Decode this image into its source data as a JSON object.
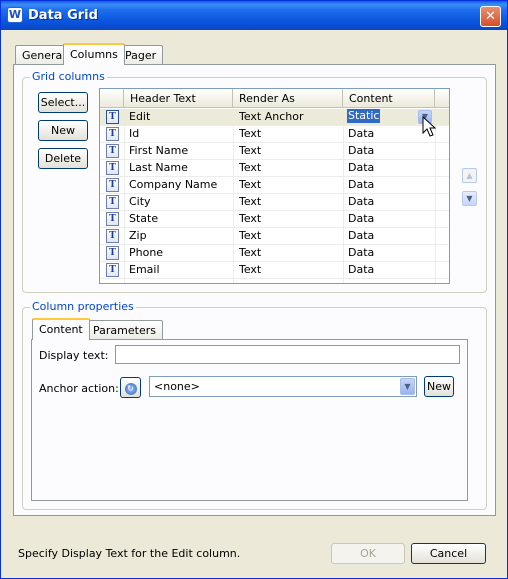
{
  "window": {
    "title": "Data Grid"
  },
  "tabs": [
    {
      "label": "General"
    },
    {
      "label": "Columns"
    },
    {
      "label": "Pager"
    }
  ],
  "grid_columns": {
    "group_label": "Grid columns",
    "buttons": {
      "select": "Select...",
      "new": "New",
      "delete": "Delete"
    },
    "headers": [
      "Header Text",
      "Render As",
      "Content Source"
    ],
    "rows": [
      {
        "icon": "T",
        "header": "Edit",
        "render": "Text Anchor",
        "source": "Static"
      },
      {
        "icon": "T",
        "header": "Id",
        "render": "Text",
        "source": "Data"
      },
      {
        "icon": "T",
        "header": "First Name",
        "render": "Text",
        "source": "Data"
      },
      {
        "icon": "T",
        "header": "Last Name",
        "render": "Text",
        "source": "Data"
      },
      {
        "icon": "T",
        "header": "Company Name",
        "render": "Text",
        "source": "Data"
      },
      {
        "icon": "T",
        "header": "City",
        "render": "Text",
        "source": "Data"
      },
      {
        "icon": "T",
        "header": "State",
        "render": "Text",
        "source": "Data"
      },
      {
        "icon": "T",
        "header": "Zip",
        "render": "Text",
        "source": "Data"
      },
      {
        "icon": "T",
        "header": "Phone",
        "render": "Text",
        "source": "Data"
      },
      {
        "icon": "T",
        "header": "Email",
        "render": "Text",
        "source": "Data"
      }
    ]
  },
  "column_properties": {
    "group_label": "Column properties",
    "tabs": [
      {
        "label": "Content"
      },
      {
        "label": "Parameters"
      }
    ],
    "display_text_label": "Display text:",
    "display_text_value": "",
    "anchor_action_label": "Anchor action:",
    "anchor_action_value": "<none>",
    "new_button": "New"
  },
  "status_text": "Specify Display Text for the Edit column.",
  "ok_label": "OK",
  "cancel_label": "Cancel",
  "colors": {
    "title_bar": "#0a5ee8",
    "selection": "#316ac5",
    "group_label": "#0046d5",
    "dialog_bg": "#ece9d8"
  }
}
